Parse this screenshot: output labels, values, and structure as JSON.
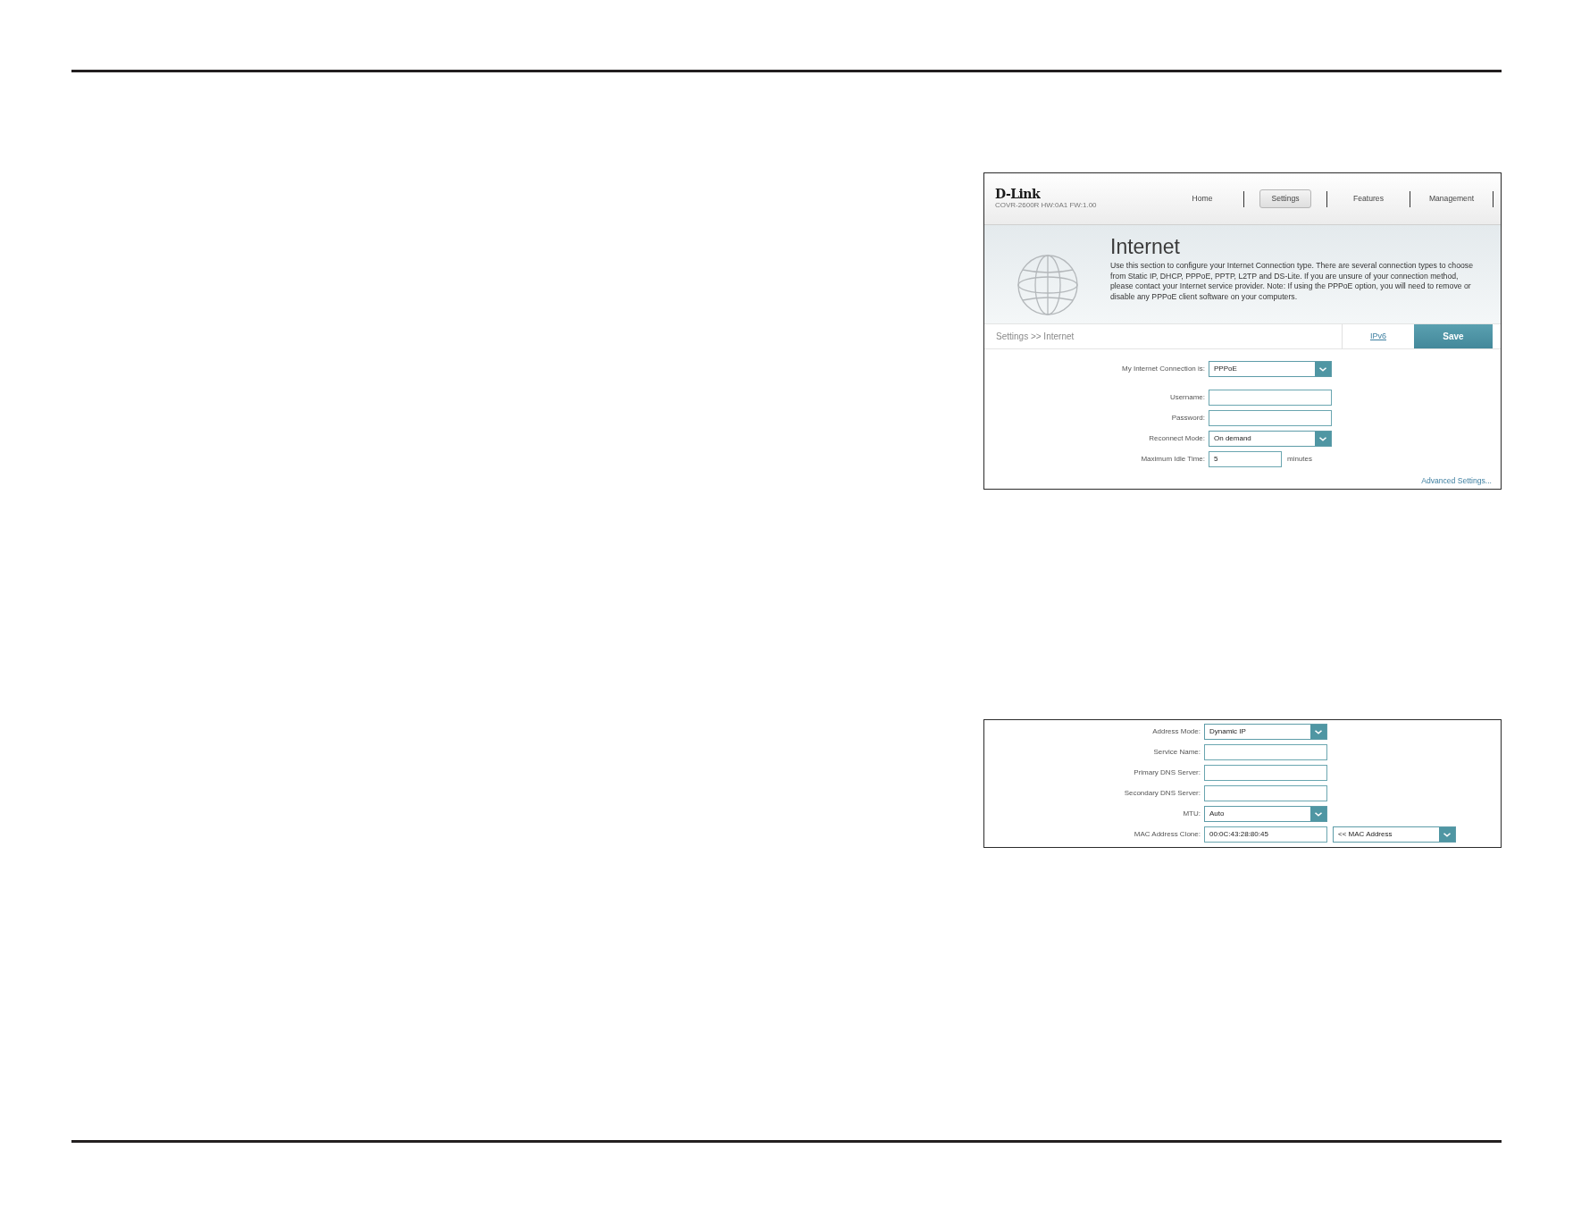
{
  "main_screenshot": {
    "logo": "D-Link",
    "model_info": "COVR-2600R HW:0A1 FW:1.00",
    "nav": [
      {
        "label": "Home",
        "selected": false
      },
      {
        "label": "Settings",
        "selected": true
      },
      {
        "label": "Features",
        "selected": false
      },
      {
        "label": "Management",
        "selected": false
      }
    ],
    "title": "Internet",
    "description_lines": [
      "Use this section to configure your Internet Connection type. There are several connection types to choose",
      "from Static IP, DHCP, PPPoE, PPTP, L2TP and DS-Lite. If you are unsure of your connection method,",
      "please contact your Internet service provider. Note: If using the PPPoE option, you will need to remove or",
      "disable any PPPoE client software on your computers."
    ],
    "breadcrumb": "Settings >> Internet",
    "ipv6_link": "IPv6",
    "save_button": "Save",
    "connection": {
      "label": "My Internet Connection is:",
      "controls": [
        {
          "kind": "select",
          "value": "PPPoE"
        }
      ]
    },
    "fields": [
      {
        "label": "Username:",
        "controls": [
          {
            "kind": "input"
          }
        ]
      },
      {
        "label": "Password:",
        "controls": [
          {
            "kind": "input"
          }
        ]
      },
      {
        "label": "Reconnect Mode:",
        "controls": [
          {
            "kind": "select",
            "value": "On demand"
          }
        ]
      },
      {
        "label": "Maximum Idle Time:",
        "controls": [
          {
            "kind": "input",
            "value": "5"
          }
        ],
        "unit": "minutes"
      }
    ],
    "advanced_link": "Advanced Settings..."
  },
  "advanced_screenshot": {
    "fields": [
      {
        "label": "Address Mode:",
        "controls": [
          {
            "kind": "select",
            "value": "Dynamic IP"
          }
        ]
      },
      {
        "label": "Service Name:",
        "controls": [
          {
            "kind": "input"
          }
        ]
      },
      {
        "label": "Primary DNS Server:",
        "controls": [
          {
            "kind": "input"
          }
        ]
      },
      {
        "label": "Secondary DNS Server:",
        "controls": [
          {
            "kind": "input"
          }
        ]
      },
      {
        "label": "MTU:",
        "controls": [
          {
            "kind": "select",
            "value": "Auto"
          }
        ]
      },
      {
        "label": "MAC Address Clone:",
        "controls": [
          {
            "kind": "input",
            "value": "00:0C:43:28:80:45"
          },
          {
            "kind": "select",
            "value": "<< MAC Address"
          }
        ]
      }
    ]
  }
}
